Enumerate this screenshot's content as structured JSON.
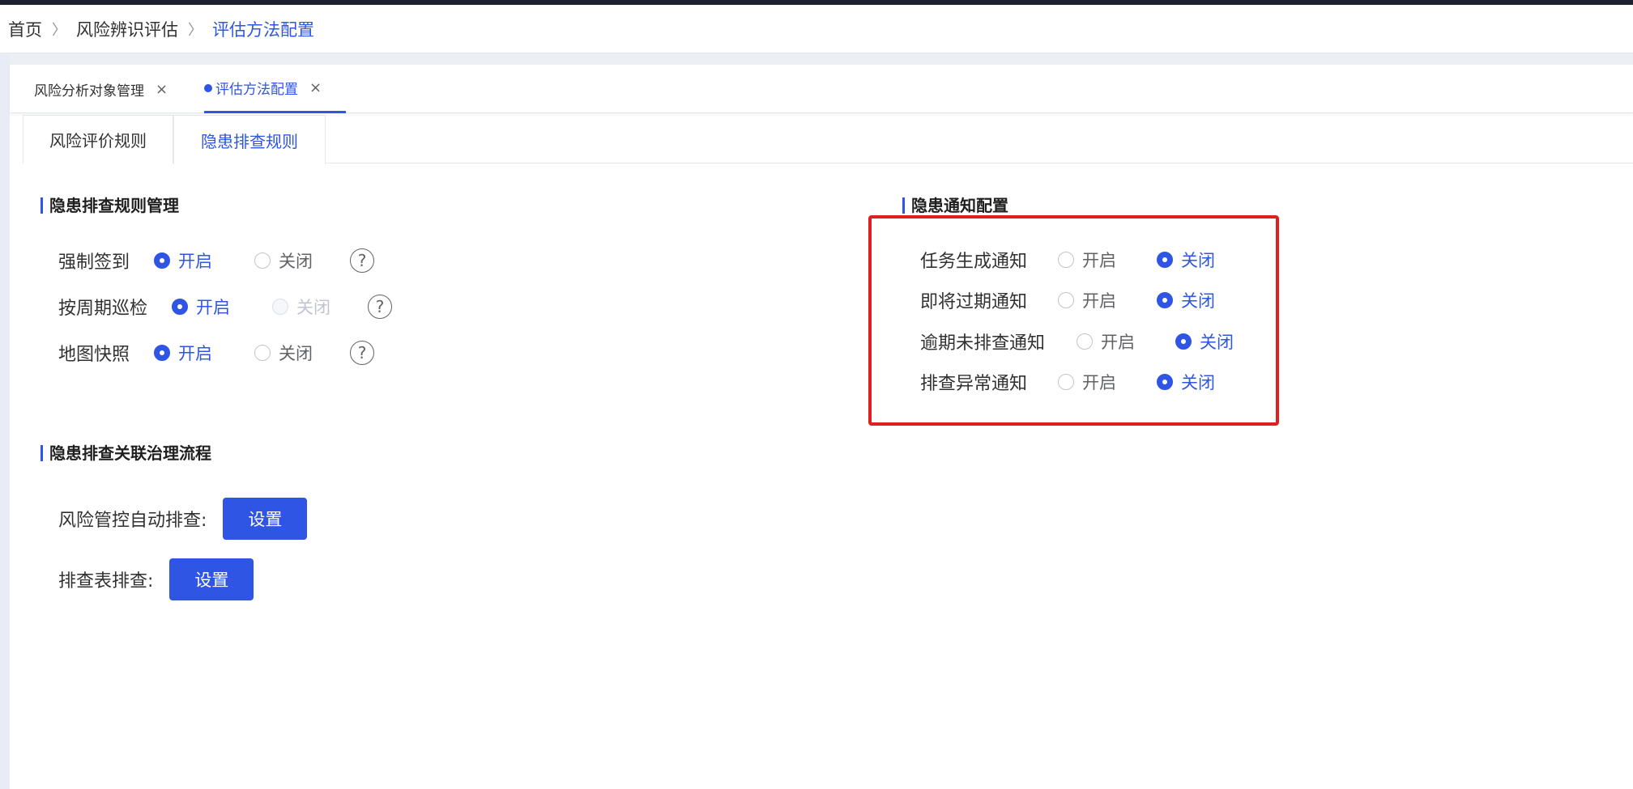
{
  "breadcrumb": {
    "items": [
      "首页",
      "风险辨识评估",
      "评估方法配置"
    ],
    "separator": ">"
  },
  "page_tabs": [
    {
      "label": "风险分析对象管理",
      "close": "×",
      "active": false
    },
    {
      "label": "评估方法配置",
      "close": "×",
      "active": true
    }
  ],
  "sub_tabs": [
    {
      "label": "风险评价规则",
      "active": false
    },
    {
      "label": "隐患排查规则",
      "active": true
    }
  ],
  "rules_section": {
    "title": "隐患排查规则管理",
    "rows": [
      {
        "label": "强制签到",
        "on": "开启",
        "off": "关闭",
        "selected": "on",
        "off_disabled": false,
        "help": "?"
      },
      {
        "label": "按周期巡检",
        "on": "开启",
        "off": "关闭",
        "selected": "on",
        "off_disabled": true,
        "help": "?"
      },
      {
        "label": "地图快照",
        "on": "开启",
        "off": "关闭",
        "selected": "on",
        "off_disabled": false,
        "help": "?"
      }
    ]
  },
  "notify_section": {
    "title": "隐患通知配置",
    "rows": [
      {
        "label": "任务生成通知",
        "on": "开启",
        "off": "关闭",
        "selected": "off"
      },
      {
        "label": "即将过期通知",
        "on": "开启",
        "off": "关闭",
        "selected": "off"
      },
      {
        "label": "逾期未排查通知",
        "on": "开启",
        "off": "关闭",
        "selected": "off"
      },
      {
        "label": "排查异常通知",
        "on": "开启",
        "off": "关闭",
        "selected": "off"
      }
    ]
  },
  "flow_section": {
    "title": "隐患排查关联治理流程",
    "items": [
      {
        "label": "风险管控自动排查:",
        "button": "设置"
      },
      {
        "label": "排查表排查:",
        "button": "设置"
      }
    ]
  },
  "colors": {
    "accent": "#2f55e4",
    "highlight": "#e02020"
  }
}
